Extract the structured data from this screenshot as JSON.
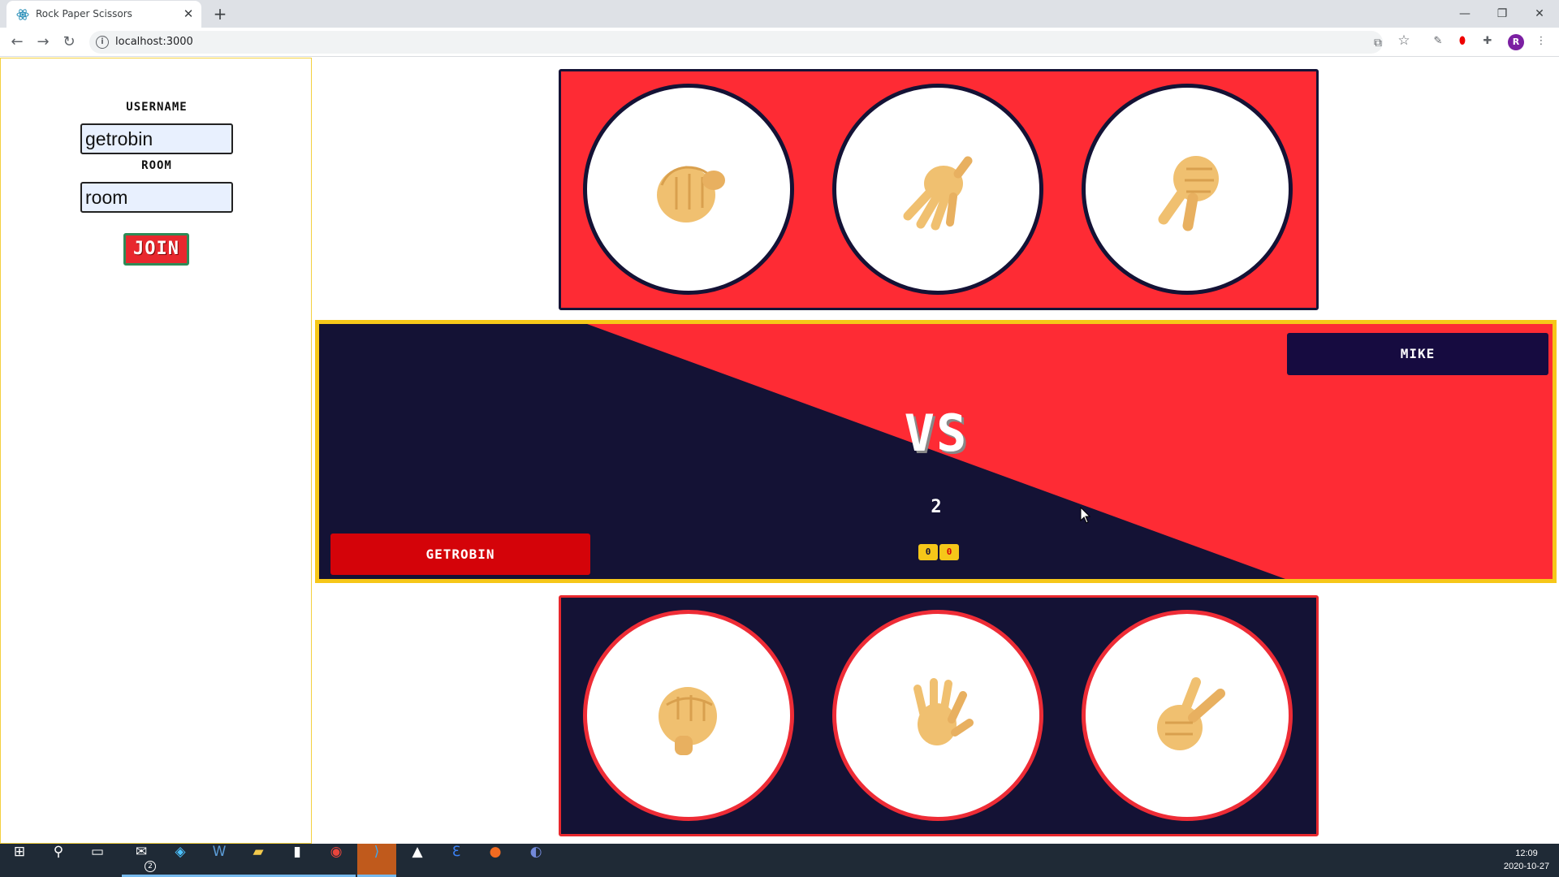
{
  "browser": {
    "tab_title": "Rock Paper Scissors",
    "tab_close": "✕",
    "new_tab": "+",
    "url": "localhost:3000",
    "window_controls": [
      "—",
      "❐",
      "✕"
    ]
  },
  "sidebar": {
    "username_label": "USERNAME",
    "username_value": "getrobin",
    "room_label": "ROOM",
    "room_value": "room",
    "join_label": "JOIN"
  },
  "game": {
    "opponent_name": "MIKE",
    "player_name": "GETROBIN",
    "vs_label": "VS",
    "round": "2",
    "scores": [
      "0",
      "0"
    ],
    "opponent_choices": [
      "rock",
      "paper",
      "scissors"
    ],
    "player_choices": [
      "rock",
      "paper",
      "scissors"
    ],
    "colors": {
      "red": "#fe2b34",
      "navy": "#141235",
      "gold": "#f6c719",
      "skin": "#f0c070"
    }
  },
  "taskbar": {
    "mail_badge": "2",
    "time": "12:09",
    "date": "2020-10-27"
  }
}
